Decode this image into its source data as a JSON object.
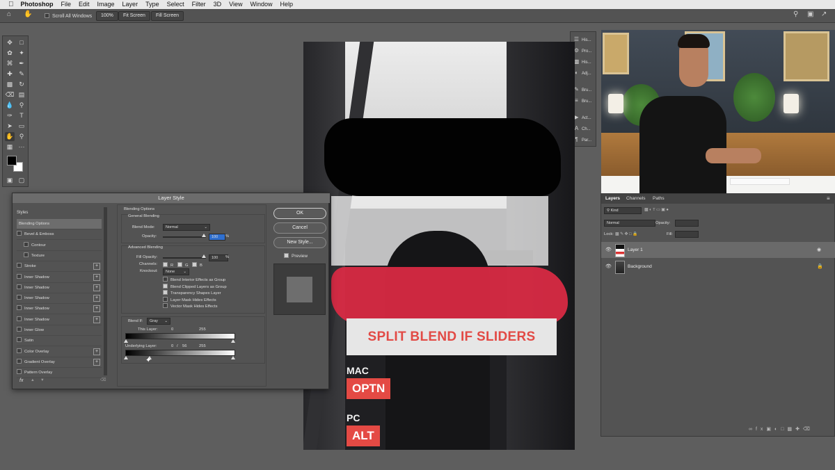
{
  "menubar": {
    "apple": "",
    "items": [
      "Photoshop",
      "File",
      "Edit",
      "Image",
      "Layer",
      "Type",
      "Select",
      "Filter",
      "3D",
      "View",
      "Window",
      "Help"
    ]
  },
  "options": {
    "scroll_all": "Scroll All Windows",
    "zoom": "100%",
    "fit1": "Fit Screen",
    "fit2": "Fill Screen"
  },
  "strip": [
    "His...",
    "Pro...",
    "His...",
    "Adj...",
    "Bru...",
    "Bru...",
    "Act...",
    "Ch...",
    "Par..."
  ],
  "dialog": {
    "title": "Layer Style",
    "styles_header": "Styles",
    "styles": [
      {
        "label": "Blending Options",
        "check": false,
        "plus": false,
        "indent": false
      },
      {
        "label": "Bevel & Emboss",
        "check": true,
        "plus": false,
        "indent": false
      },
      {
        "label": "Contour",
        "check": true,
        "plus": false,
        "indent": true
      },
      {
        "label": "Texture",
        "check": true,
        "plus": false,
        "indent": true
      },
      {
        "label": "Stroke",
        "check": true,
        "plus": true,
        "indent": false
      },
      {
        "label": "Inner Shadow",
        "check": true,
        "plus": true,
        "indent": false
      },
      {
        "label": "Inner Shadow",
        "check": true,
        "plus": true,
        "indent": false
      },
      {
        "label": "Inner Shadow",
        "check": true,
        "plus": true,
        "indent": false
      },
      {
        "label": "Inner Shadow",
        "check": true,
        "plus": true,
        "indent": false
      },
      {
        "label": "Inner Shadow",
        "check": true,
        "plus": true,
        "indent": false
      },
      {
        "label": "Inner Glow",
        "check": true,
        "plus": false,
        "indent": false
      },
      {
        "label": "Satin",
        "check": true,
        "plus": false,
        "indent": false
      },
      {
        "label": "Color Overlay",
        "check": true,
        "plus": true,
        "indent": false
      },
      {
        "label": "Gradient Overlay",
        "check": true,
        "plus": true,
        "indent": false
      },
      {
        "label": "Pattern Overlay",
        "check": true,
        "plus": false,
        "indent": false
      }
    ],
    "blending_options": "Blending Options",
    "general_blending": "General Blending",
    "blend_mode_label": "Blend Mode:",
    "blend_mode": "Normal",
    "opacity_label": "Opacity:",
    "opacity": "100",
    "pct": "%",
    "advanced_blending": "Advanced Blending",
    "fill_opacity_label": "Fill Opacity:",
    "fill_opacity": "100",
    "channels_label": "Channels:",
    "ch_r": "R",
    "ch_g": "G",
    "ch_b": "B",
    "knockout_label": "Knockout:",
    "knockout": "None",
    "checks": [
      {
        "label": "Blend Interior Effects as Group",
        "on": false
      },
      {
        "label": "Blend Clipped Layers as Group",
        "on": true
      },
      {
        "label": "Transparency Shapes Layer",
        "on": true
      },
      {
        "label": "Layer Mask Hides Effects",
        "on": false
      },
      {
        "label": "Vector Mask Hides Effects",
        "on": false
      }
    ],
    "blend_if_label": "Blend If:",
    "blend_if": "Gray",
    "this_layer_label": "This Layer:",
    "this_layer_lo": "0",
    "this_layer_hi": "255",
    "underlying_label": "Underlying Layer:",
    "underlying_a": "0",
    "underlying_slash": "/",
    "underlying_b": "56",
    "underlying_hi": "255",
    "slider_underlying_split": 56,
    "ok": "OK",
    "cancel": "Cancel",
    "new_style": "New Style...",
    "preview": "Preview",
    "fx": "fx"
  },
  "canvas": {
    "title": "SPLIT BLEND IF SLIDERS",
    "mac_label": "MAC",
    "mac_key": "OPTN",
    "pc_label": "PC",
    "pc_key": "ALT"
  },
  "layers": {
    "tab_layers": "Layers",
    "tab_channels": "Channels",
    "tab_paths": "Paths",
    "kind": "Kind",
    "mode": "Normal",
    "opacity_label": "Opacity:",
    "lock_label": "Lock:",
    "fill_label": "Fill:",
    "rows": [
      "Layer 1",
      "Background"
    ]
  },
  "colors": {
    "accent_red": "#e44a44",
    "ui_gray": "#535353"
  }
}
